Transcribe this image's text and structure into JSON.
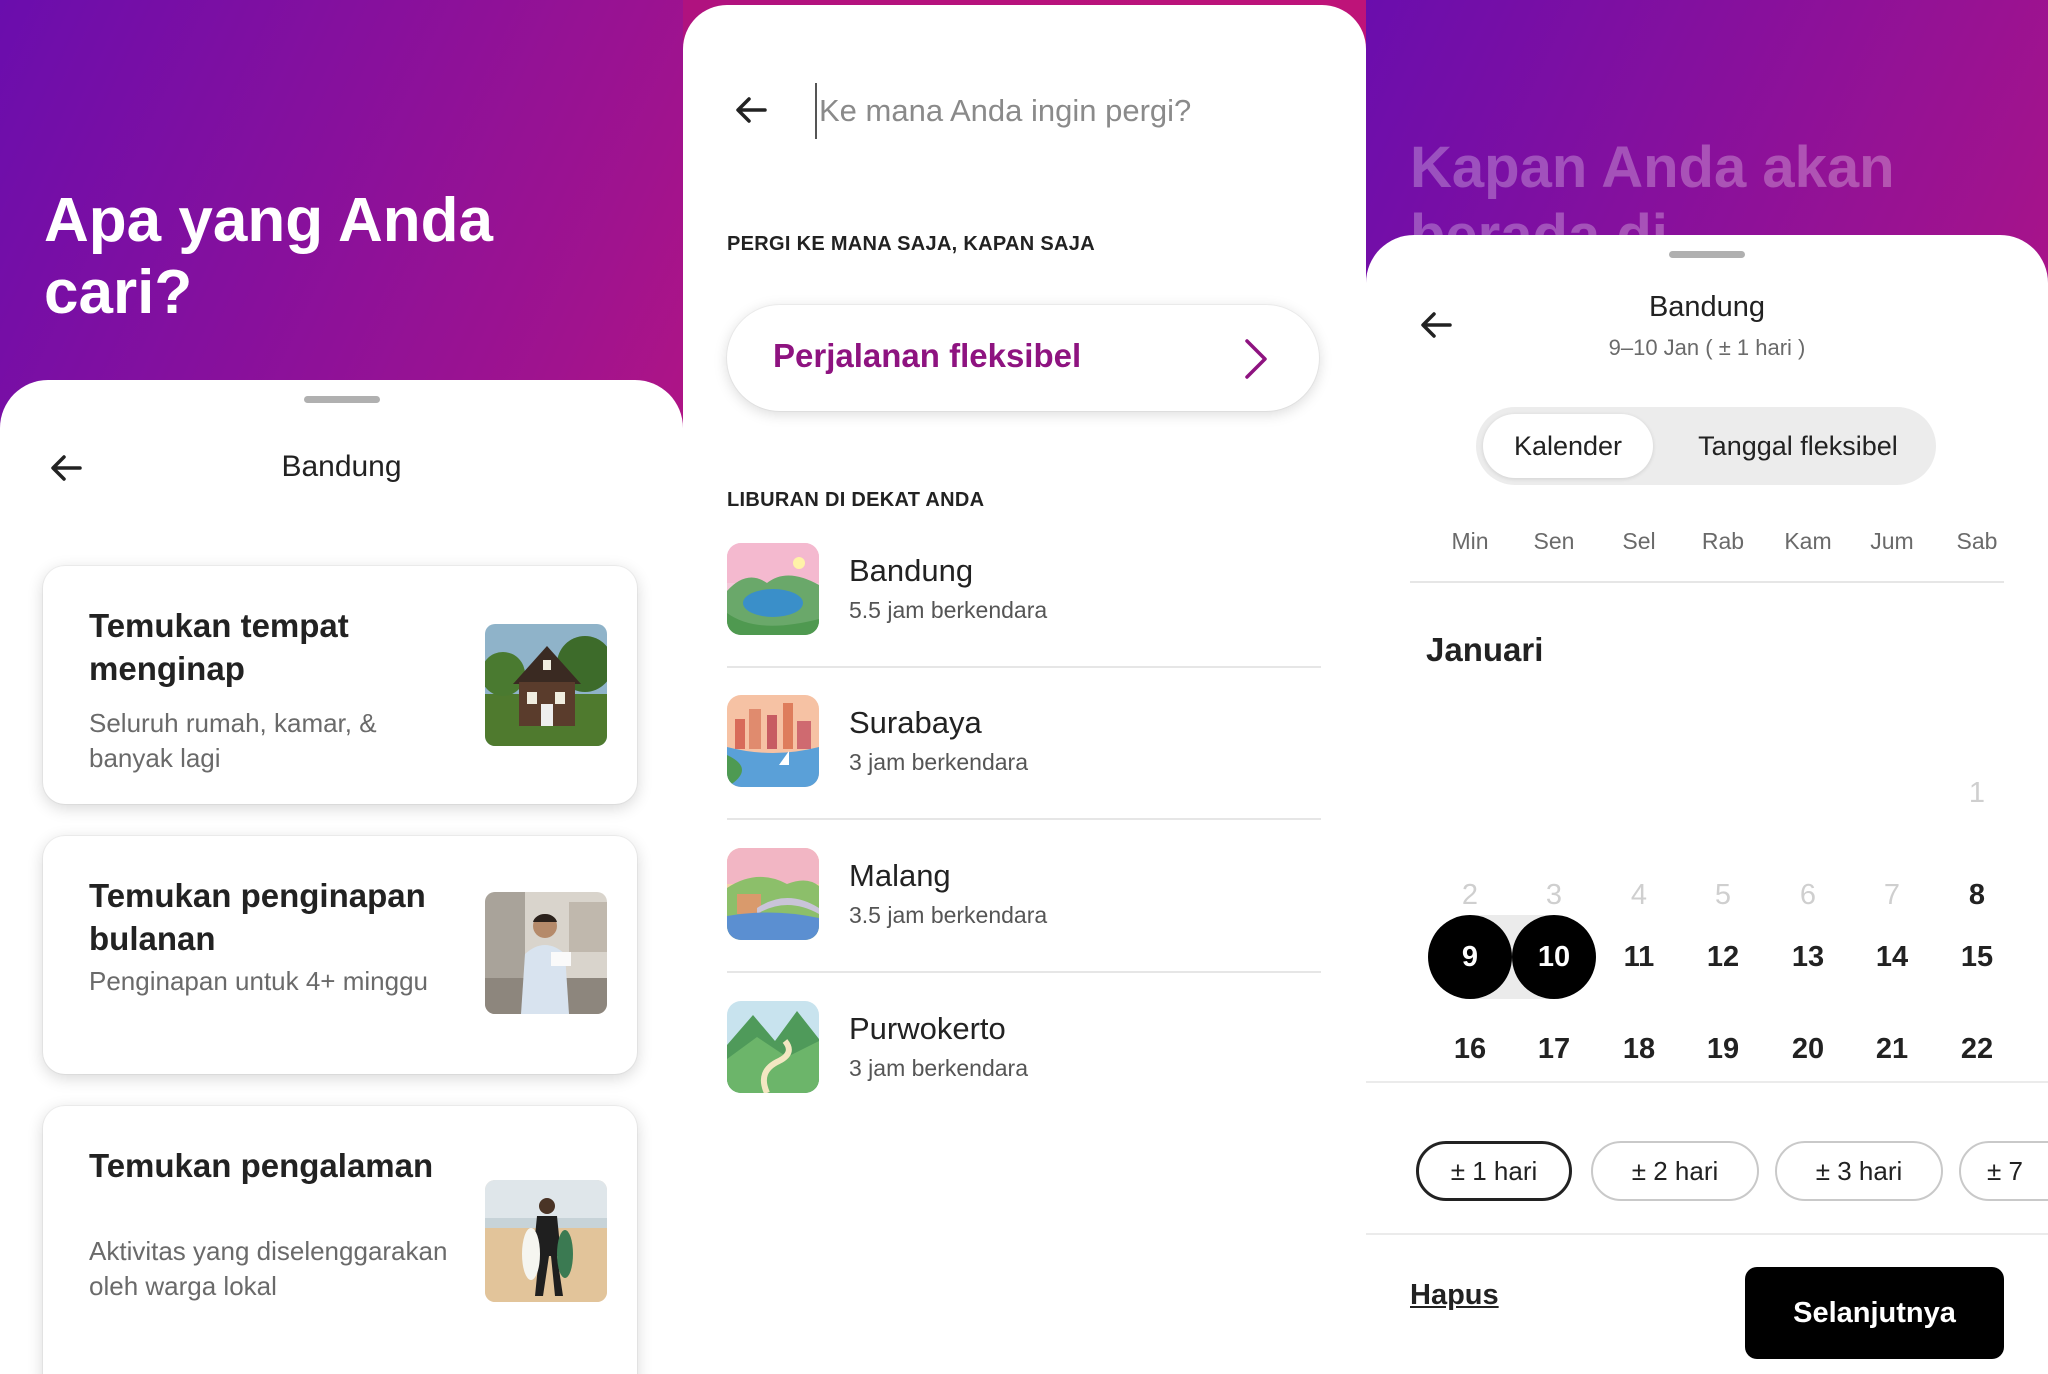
{
  "panel1": {
    "hero_title": "Apa yang Anda cari?",
    "sheet_title": "Bandung",
    "cards": [
      {
        "title": "Temukan tempat menginap",
        "subtitle": "Seluruh rumah, kamar, & banyak lagi",
        "image": "house-photo"
      },
      {
        "title": "Temukan penginapan bulanan",
        "subtitle": "Penginapan untuk 4+ minggu",
        "image": "person-kitchen-photo"
      },
      {
        "title": "Temukan pengalaman",
        "subtitle": "Aktivitas yang diselenggarakan oleh warga lokal",
        "image": "surfer-beach-photo"
      }
    ]
  },
  "panel2": {
    "search_placeholder": "Ke mana Anda ingin pergi?",
    "section_anywhere": "PERGI KE MANA SAJA, KAPAN SAJA",
    "flexible_label": "Perjalanan fleksibel",
    "section_nearby": "LIBURAN DI DEKAT ANDA",
    "destinations": [
      {
        "name": "Bandung",
        "time": "5.5 jam berkendara"
      },
      {
        "name": "Surabaya",
        "time": "3 jam berkendara"
      },
      {
        "name": "Malang",
        "time": "3.5 jam berkendara"
      },
      {
        "name": "Purwokerto",
        "time": "3 jam berkendara"
      }
    ]
  },
  "panel3": {
    "ghost_title": "Kapan Anda akan berada di",
    "location_title": "Bandung",
    "date_summary": "9–10 Jan ( ± 1 hari )",
    "tabs": {
      "calendar": "Kalender",
      "flexible": "Tanggal fleksibel"
    },
    "weekdays": [
      "Min",
      "Sen",
      "Sel",
      "Rab",
      "Kam",
      "Jum",
      "Sab"
    ],
    "month": "Januari",
    "days": {
      "d1": "1",
      "d2": "2",
      "d3": "3",
      "d4": "4",
      "d5": "5",
      "d6": "6",
      "d7": "7",
      "d8": "8",
      "d9": "9",
      "d10": "10",
      "d11": "11",
      "d12": "12",
      "d13": "13",
      "d14": "14",
      "d15": "15",
      "d16": "16",
      "d17": "17",
      "d18": "18",
      "d19": "19",
      "d20": "20",
      "d21": "21",
      "d22": "22"
    },
    "chips": [
      "± 1 hari",
      "± 2 hari",
      "± 3 hari",
      "± 7"
    ],
    "clear_label": "Hapus",
    "next_label": "Selanjutnya"
  }
}
